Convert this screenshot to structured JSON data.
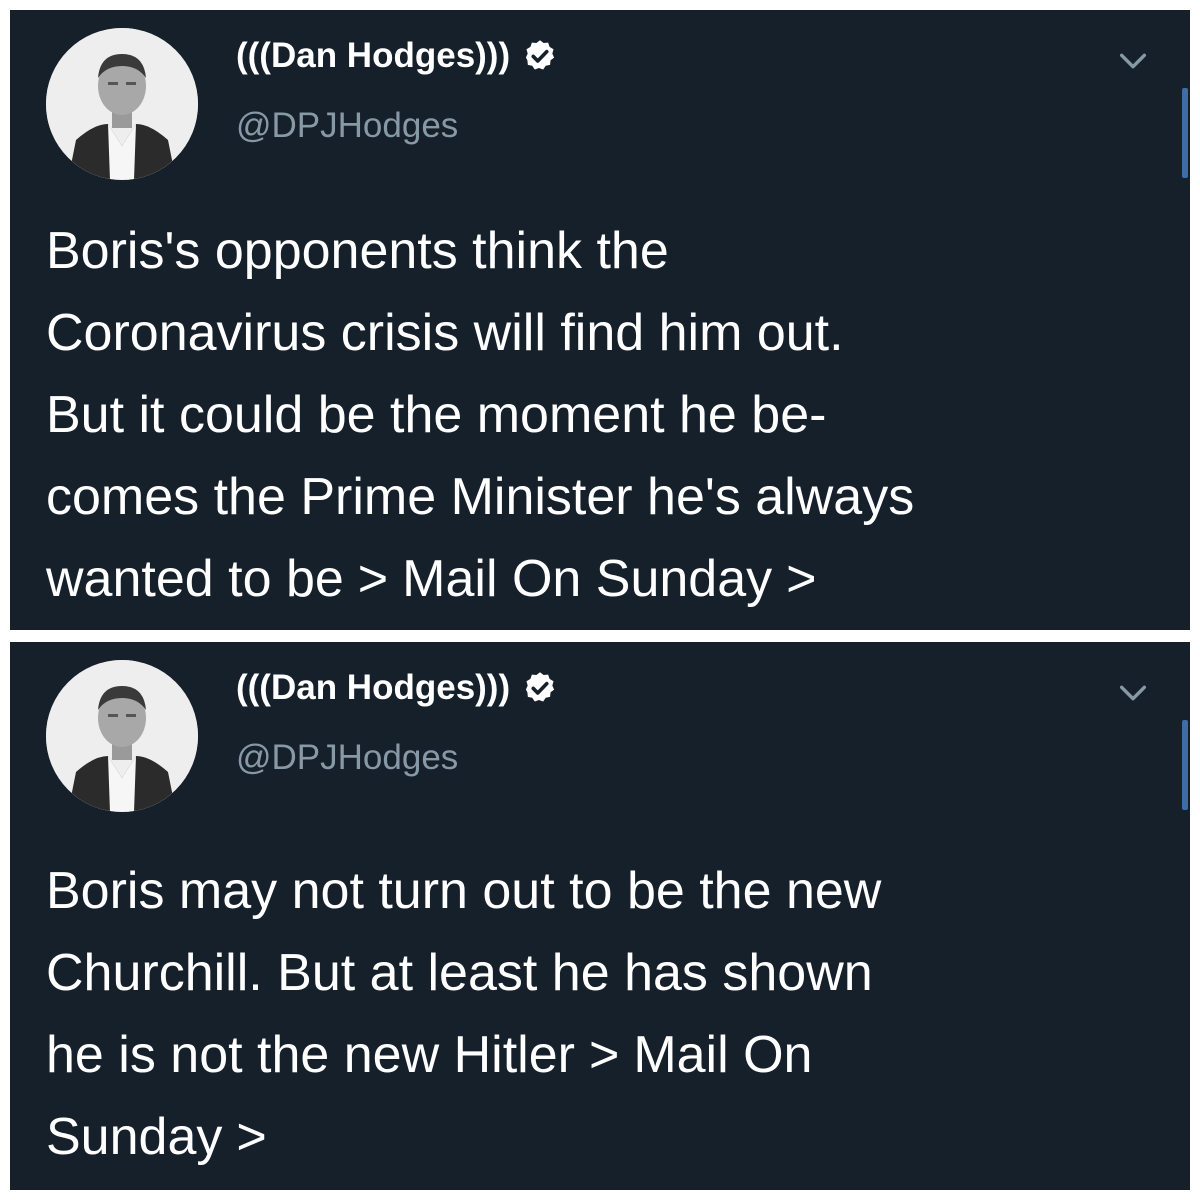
{
  "tweets": [
    {
      "display_name": "(((Dan Hodges)))",
      "handle": "@DPJHodges",
      "lines": [
        "Boris's opponents think the",
        "Coronavirus crisis will find him out.",
        "But it could be the moment he be-",
        "comes the Prime Minister he's always"
      ],
      "last_line": {
        "text": "wanted to be",
        "sep1": ">",
        "link": "Mail On Sunday",
        "sep2": ">"
      }
    },
    {
      "display_name": "(((Dan Hodges)))",
      "handle": "@DPJHodges",
      "lines": [
        "Boris may not turn out to be the new",
        "Churchill. But at least he has shown"
      ],
      "line3": {
        "text": "he is not the new Hitler",
        "sep1": ">",
        "link": "Mail On"
      },
      "line4": {
        "link": "Sunday",
        "sep2": ">"
      }
    }
  ],
  "colors": {
    "background": "#15202b",
    "text": "#ffffff",
    "muted": "#8899a6",
    "verified_badge": "#ffffff",
    "scrollbar": "#3a6ea5"
  },
  "icons": {
    "verified": "verified-badge-icon",
    "menu": "chevron-down-icon"
  }
}
